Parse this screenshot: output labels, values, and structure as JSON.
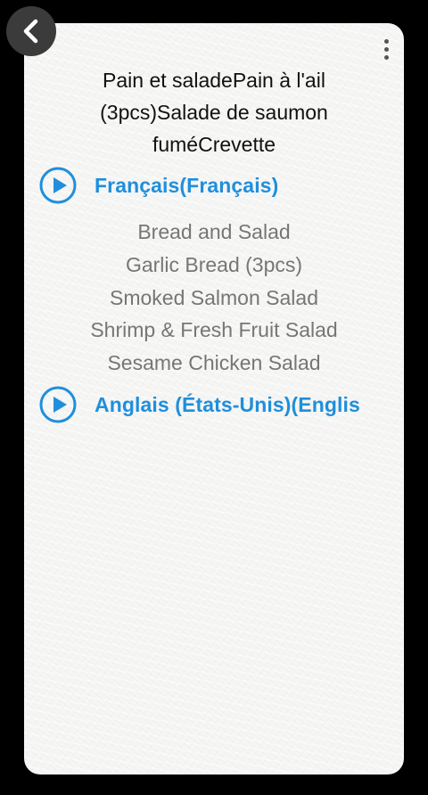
{
  "back_button": {
    "icon": "chevron-left-icon"
  },
  "menu": {
    "icon": "more-vertical-icon"
  },
  "source_text": "Pain et saladePain à l'ail\n(3pcs)Salade de saumon\nfuméCrevette",
  "audio": {
    "source_language": {
      "label": "Français(Français)",
      "icon": "play-circle-icon"
    },
    "target_language": {
      "label": "Anglais (États-Unis)(Englis",
      "icon": "play-circle-icon"
    }
  },
  "translation": {
    "lines": [
      "Bread and Salad",
      "Garlic Bread (3pcs)",
      "Smoked Salmon Salad",
      "Shrimp & Fresh Fruit Salad",
      "Sesame Chicken Salad"
    ]
  },
  "colors": {
    "accent": "#1f8fdc",
    "card_background": "#f6f6f5",
    "screen_background": "#000000",
    "translation_text": "#767676",
    "source_text": "#111111",
    "back_button_bg": "#3b3b3b"
  }
}
